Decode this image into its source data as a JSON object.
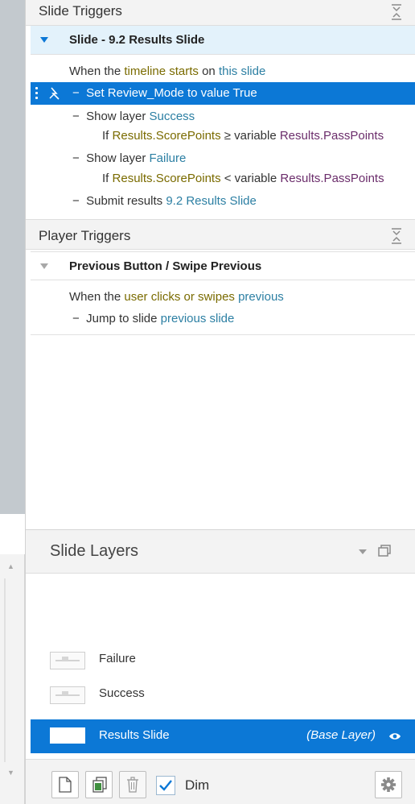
{
  "slide_triggers": {
    "title": "Slide Triggers",
    "group_label": "Slide - 9.2 Results Slide",
    "event": {
      "prefix": "When the ",
      "what": "timeline starts",
      "mid": " on ",
      "target": "this slide"
    },
    "actions": [
      {
        "dash": "−",
        "text_a": "Set Review_Mode to value True",
        "selected": true
      },
      {
        "dash": "−",
        "a": "Show layer ",
        "b": "Success",
        "cond": {
          "if": "If ",
          "v1": "Results.ScorePoints",
          "op": " ≥ variable ",
          "v2": "Results.PassPoints"
        }
      },
      {
        "dash": "−",
        "a": "Show layer ",
        "b": "Failure",
        "cond": {
          "if": "If ",
          "v1": "Results.ScorePoints",
          "op": " < variable ",
          "v2": "Results.PassPoints"
        }
      },
      {
        "dash": "−",
        "a": "Submit results ",
        "b": "9.2 Results Slide"
      }
    ]
  },
  "player_triggers": {
    "title": "Player Triggers",
    "group_label": "Previous Button / Swipe Previous",
    "event": {
      "prefix": "When the ",
      "what": "user clicks or swipes",
      "mid": " ",
      "target": "previous"
    },
    "action": {
      "dash": "−",
      "a": "Jump to slide ",
      "b": "previous slide"
    }
  },
  "slide_layers": {
    "title": "Slide Layers",
    "layers": [
      {
        "name": "Failure"
      },
      {
        "name": "Success"
      },
      {
        "name": "Results Slide",
        "tag": "(Base Layer)",
        "selected": true
      }
    ],
    "dim_label": "Dim",
    "dim_checked": true
  },
  "colors": {
    "selection": "#0c78d6",
    "link_blue": "#2c7fa3",
    "variable_olive": "#7a6b00",
    "variable_purple": "#6b2d6b"
  },
  "icons": [
    "collapse-all-icon",
    "lightning-icon",
    "popout-icon",
    "eye-icon",
    "new-layer-icon",
    "duplicate-layer-icon",
    "trash-icon",
    "checkmark-icon",
    "gear-icon"
  ]
}
